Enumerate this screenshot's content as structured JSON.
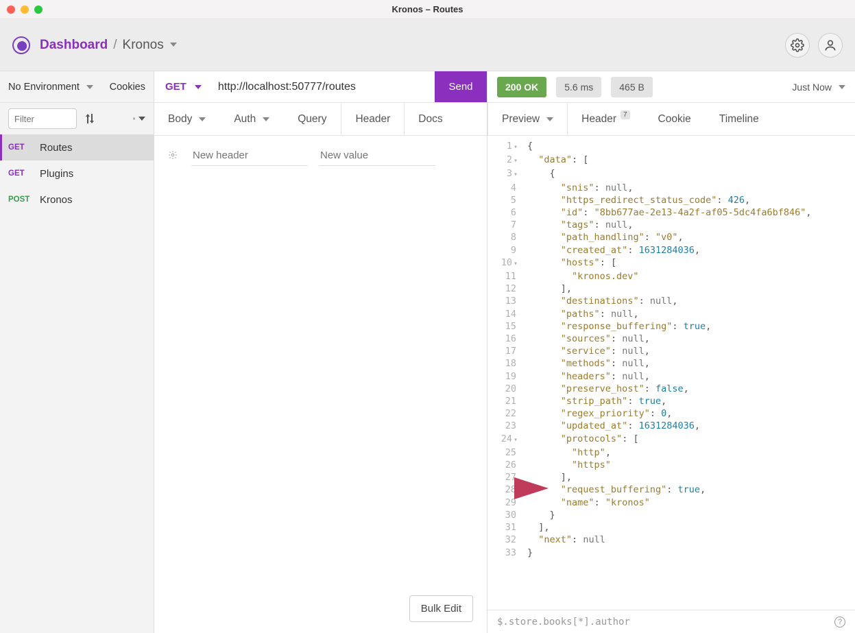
{
  "window": {
    "title": "Kronos – Routes"
  },
  "header": {
    "breadcrumb_dashboard": "Dashboard",
    "breadcrumb_sep": "/",
    "breadcrumb_workspace": "Kronos"
  },
  "sidebar": {
    "environment_label": "No Environment",
    "cookies_label": "Cookies",
    "filter_placeholder": "Filter",
    "requests": [
      {
        "method": "GET",
        "name": "Routes",
        "active": true
      },
      {
        "method": "GET",
        "name": "Plugins",
        "active": false
      },
      {
        "method": "POST",
        "name": "Kronos",
        "active": false
      }
    ]
  },
  "request": {
    "method": "GET",
    "url": "http://localhost:50777/routes",
    "send_label": "Send",
    "tabs": {
      "body": "Body",
      "auth": "Auth",
      "query": "Query",
      "header": "Header",
      "docs": "Docs"
    },
    "header_editor": {
      "new_header_placeholder": "New header",
      "new_value_placeholder": "New value"
    },
    "bulk_edit_label": "Bulk Edit"
  },
  "response": {
    "status_text": "200 OK",
    "time_text": "5.6 ms",
    "size_text": "465 B",
    "when_text": "Just Now",
    "tabs": {
      "preview": "Preview",
      "header": "Header",
      "header_count": "7",
      "cookie": "Cookie",
      "timeline": "Timeline"
    },
    "jsonpath_placeholder": "$.store.books[*].author",
    "body_lines": [
      {
        "n": 1,
        "fold": true,
        "tokens": [
          {
            "t": "punc",
            "v": "{"
          }
        ]
      },
      {
        "n": 2,
        "fold": true,
        "tokens": [
          {
            "t": "txt",
            "v": "  "
          },
          {
            "t": "key",
            "v": "\"data\""
          },
          {
            "t": "punc",
            "v": ": ["
          }
        ]
      },
      {
        "n": 3,
        "fold": true,
        "tokens": [
          {
            "t": "txt",
            "v": "    "
          },
          {
            "t": "punc",
            "v": "{"
          }
        ]
      },
      {
        "n": 4,
        "fold": false,
        "tokens": [
          {
            "t": "txt",
            "v": "      "
          },
          {
            "t": "key",
            "v": "\"snis\""
          },
          {
            "t": "punc",
            "v": ": "
          },
          {
            "t": "null",
            "v": "null"
          },
          {
            "t": "punc",
            "v": ","
          }
        ]
      },
      {
        "n": 5,
        "fold": false,
        "tokens": [
          {
            "t": "txt",
            "v": "      "
          },
          {
            "t": "key",
            "v": "\"https_redirect_status_code\""
          },
          {
            "t": "punc",
            "v": ": "
          },
          {
            "t": "num",
            "v": "426"
          },
          {
            "t": "punc",
            "v": ","
          }
        ]
      },
      {
        "n": 6,
        "fold": false,
        "tokens": [
          {
            "t": "txt",
            "v": "      "
          },
          {
            "t": "key",
            "v": "\"id\""
          },
          {
            "t": "punc",
            "v": ": "
          },
          {
            "t": "str",
            "v": "\"8bb677ae-2e13-4a2f-af05-5dc4fa6bf846\""
          },
          {
            "t": "punc",
            "v": ","
          }
        ]
      },
      {
        "n": 7,
        "fold": false,
        "tokens": [
          {
            "t": "txt",
            "v": "      "
          },
          {
            "t": "key",
            "v": "\"tags\""
          },
          {
            "t": "punc",
            "v": ": "
          },
          {
            "t": "null",
            "v": "null"
          },
          {
            "t": "punc",
            "v": ","
          }
        ]
      },
      {
        "n": 8,
        "fold": false,
        "tokens": [
          {
            "t": "txt",
            "v": "      "
          },
          {
            "t": "key",
            "v": "\"path_handling\""
          },
          {
            "t": "punc",
            "v": ": "
          },
          {
            "t": "str",
            "v": "\"v0\""
          },
          {
            "t": "punc",
            "v": ","
          }
        ]
      },
      {
        "n": 9,
        "fold": false,
        "tokens": [
          {
            "t": "txt",
            "v": "      "
          },
          {
            "t": "key",
            "v": "\"created_at\""
          },
          {
            "t": "punc",
            "v": ": "
          },
          {
            "t": "num",
            "v": "1631284036"
          },
          {
            "t": "punc",
            "v": ","
          }
        ]
      },
      {
        "n": 10,
        "fold": true,
        "tokens": [
          {
            "t": "txt",
            "v": "      "
          },
          {
            "t": "key",
            "v": "\"hosts\""
          },
          {
            "t": "punc",
            "v": ": ["
          }
        ]
      },
      {
        "n": 11,
        "fold": false,
        "tokens": [
          {
            "t": "txt",
            "v": "        "
          },
          {
            "t": "str",
            "v": "\"kronos.dev\""
          }
        ]
      },
      {
        "n": 12,
        "fold": false,
        "tokens": [
          {
            "t": "txt",
            "v": "      "
          },
          {
            "t": "punc",
            "v": "],"
          }
        ]
      },
      {
        "n": 13,
        "fold": false,
        "tokens": [
          {
            "t": "txt",
            "v": "      "
          },
          {
            "t": "key",
            "v": "\"destinations\""
          },
          {
            "t": "punc",
            "v": ": "
          },
          {
            "t": "null",
            "v": "null"
          },
          {
            "t": "punc",
            "v": ","
          }
        ]
      },
      {
        "n": 14,
        "fold": false,
        "tokens": [
          {
            "t": "txt",
            "v": "      "
          },
          {
            "t": "key",
            "v": "\"paths\""
          },
          {
            "t": "punc",
            "v": ": "
          },
          {
            "t": "null",
            "v": "null"
          },
          {
            "t": "punc",
            "v": ","
          }
        ]
      },
      {
        "n": 15,
        "fold": false,
        "tokens": [
          {
            "t": "txt",
            "v": "      "
          },
          {
            "t": "key",
            "v": "\"response_buffering\""
          },
          {
            "t": "punc",
            "v": ": "
          },
          {
            "t": "bool",
            "v": "true"
          },
          {
            "t": "punc",
            "v": ","
          }
        ]
      },
      {
        "n": 16,
        "fold": false,
        "tokens": [
          {
            "t": "txt",
            "v": "      "
          },
          {
            "t": "key",
            "v": "\"sources\""
          },
          {
            "t": "punc",
            "v": ": "
          },
          {
            "t": "null",
            "v": "null"
          },
          {
            "t": "punc",
            "v": ","
          }
        ]
      },
      {
        "n": 17,
        "fold": false,
        "tokens": [
          {
            "t": "txt",
            "v": "      "
          },
          {
            "t": "key",
            "v": "\"service\""
          },
          {
            "t": "punc",
            "v": ": "
          },
          {
            "t": "null",
            "v": "null"
          },
          {
            "t": "punc",
            "v": ","
          }
        ]
      },
      {
        "n": 18,
        "fold": false,
        "tokens": [
          {
            "t": "txt",
            "v": "      "
          },
          {
            "t": "key",
            "v": "\"methods\""
          },
          {
            "t": "punc",
            "v": ": "
          },
          {
            "t": "null",
            "v": "null"
          },
          {
            "t": "punc",
            "v": ","
          }
        ]
      },
      {
        "n": 19,
        "fold": false,
        "tokens": [
          {
            "t": "txt",
            "v": "      "
          },
          {
            "t": "key",
            "v": "\"headers\""
          },
          {
            "t": "punc",
            "v": ": "
          },
          {
            "t": "null",
            "v": "null"
          },
          {
            "t": "punc",
            "v": ","
          }
        ]
      },
      {
        "n": 20,
        "fold": false,
        "tokens": [
          {
            "t": "txt",
            "v": "      "
          },
          {
            "t": "key",
            "v": "\"preserve_host\""
          },
          {
            "t": "punc",
            "v": ": "
          },
          {
            "t": "bool",
            "v": "false"
          },
          {
            "t": "punc",
            "v": ","
          }
        ]
      },
      {
        "n": 21,
        "fold": false,
        "tokens": [
          {
            "t": "txt",
            "v": "      "
          },
          {
            "t": "key",
            "v": "\"strip_path\""
          },
          {
            "t": "punc",
            "v": ": "
          },
          {
            "t": "bool",
            "v": "true"
          },
          {
            "t": "punc",
            "v": ","
          }
        ]
      },
      {
        "n": 22,
        "fold": false,
        "tokens": [
          {
            "t": "txt",
            "v": "      "
          },
          {
            "t": "key",
            "v": "\"regex_priority\""
          },
          {
            "t": "punc",
            "v": ": "
          },
          {
            "t": "num",
            "v": "0"
          },
          {
            "t": "punc",
            "v": ","
          }
        ]
      },
      {
        "n": 23,
        "fold": false,
        "tokens": [
          {
            "t": "txt",
            "v": "      "
          },
          {
            "t": "key",
            "v": "\"updated_at\""
          },
          {
            "t": "punc",
            "v": ": "
          },
          {
            "t": "num",
            "v": "1631284036"
          },
          {
            "t": "punc",
            "v": ","
          }
        ]
      },
      {
        "n": 24,
        "fold": true,
        "tokens": [
          {
            "t": "txt",
            "v": "      "
          },
          {
            "t": "key",
            "v": "\"protocols\""
          },
          {
            "t": "punc",
            "v": ": ["
          }
        ]
      },
      {
        "n": 25,
        "fold": false,
        "tokens": [
          {
            "t": "txt",
            "v": "        "
          },
          {
            "t": "str",
            "v": "\"http\""
          },
          {
            "t": "punc",
            "v": ","
          }
        ]
      },
      {
        "n": 26,
        "fold": false,
        "tokens": [
          {
            "t": "txt",
            "v": "        "
          },
          {
            "t": "str",
            "v": "\"https\""
          }
        ]
      },
      {
        "n": 27,
        "fold": false,
        "tokens": [
          {
            "t": "txt",
            "v": "      "
          },
          {
            "t": "punc",
            "v": "],"
          }
        ]
      },
      {
        "n": 28,
        "fold": false,
        "tokens": [
          {
            "t": "txt",
            "v": "      "
          },
          {
            "t": "key",
            "v": "\"request_buffering\""
          },
          {
            "t": "punc",
            "v": ": "
          },
          {
            "t": "bool",
            "v": "true"
          },
          {
            "t": "punc",
            "v": ","
          }
        ]
      },
      {
        "n": 29,
        "fold": false,
        "tokens": [
          {
            "t": "txt",
            "v": "      "
          },
          {
            "t": "key",
            "v": "\"name\""
          },
          {
            "t": "punc",
            "v": ": "
          },
          {
            "t": "str",
            "v": "\"kronos\""
          }
        ]
      },
      {
        "n": 30,
        "fold": false,
        "tokens": [
          {
            "t": "txt",
            "v": "    "
          },
          {
            "t": "punc",
            "v": "}"
          }
        ]
      },
      {
        "n": 31,
        "fold": false,
        "tokens": [
          {
            "t": "txt",
            "v": "  "
          },
          {
            "t": "punc",
            "v": "],"
          }
        ]
      },
      {
        "n": 32,
        "fold": false,
        "tokens": [
          {
            "t": "txt",
            "v": "  "
          },
          {
            "t": "key",
            "v": "\"next\""
          },
          {
            "t": "punc",
            "v": ": "
          },
          {
            "t": "null",
            "v": "null"
          }
        ]
      },
      {
        "n": 33,
        "fold": false,
        "tokens": [
          {
            "t": "punc",
            "v": "}"
          }
        ]
      }
    ]
  }
}
